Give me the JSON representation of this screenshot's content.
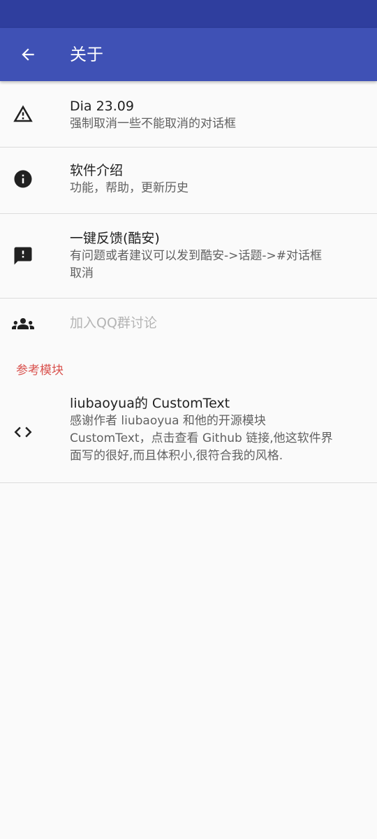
{
  "app_bar": {
    "title": "关于",
    "back_icon": "arrow-back-icon"
  },
  "items": [
    {
      "icon": "warning-icon",
      "title": "Dia 23.09",
      "summary": "强制取消一些不能取消的对话框"
    },
    {
      "icon": "info-icon",
      "title": "软件介绍",
      "summary": "功能，帮助，更新历史"
    },
    {
      "icon": "feedback-icon",
      "title": "一键反馈(酷安)",
      "summary_line1": "有问题或者建议可以发到酷安->话题->#对话框",
      "summary_line2": "取消"
    },
    {
      "icon": "group-icon",
      "title": "加入QQ群讨论",
      "enabled": false
    }
  ],
  "section": {
    "header": "参考模块"
  },
  "reference": {
    "icon": "code-icon",
    "title": "liubaoyua的 CustomText",
    "summary_line1": "感谢作者 liubaoyua 和他的开源模块",
    "summary_line2": "CustomText，点击查看 Github 链接,他这软件界",
    "summary_line3": "面写的很好,而且体积小,很符合我的风格."
  },
  "colors": {
    "status_bar": "#2f3e9e",
    "app_bar": "#3f51b5",
    "section_header": "#d9534f",
    "background": "#fafafa"
  }
}
